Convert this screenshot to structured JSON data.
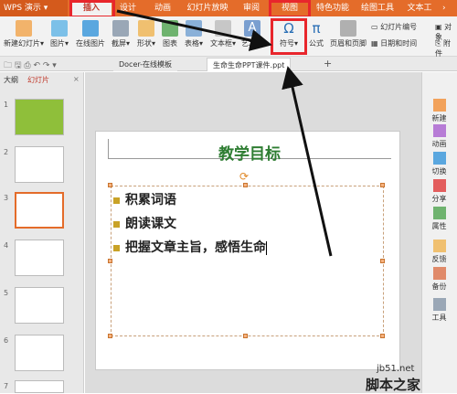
{
  "app": {
    "name": "WPS 演示"
  },
  "tabs": [
    "插入",
    "设计",
    "动画",
    "幻灯片放映",
    "审阅",
    "视图",
    "特色功能",
    "绘图工具",
    "文本工"
  ],
  "ribbon": {
    "new_slide": "新建幻灯片",
    "image": "图片",
    "online_image": "在线图片",
    "screenshot": "截屏",
    "shape": "形状",
    "chart": "图表",
    "table": "表格",
    "textbox": "文本框",
    "art": "艺术字",
    "symbol": "符号",
    "formula": "公式",
    "header_footer": "页眉和页脚",
    "slide_number": "幻灯片编号",
    "datetime": "日期和时间",
    "object": "对象",
    "attachment": "附件"
  },
  "doc_tabs": [
    "Docer-在线模板",
    "生命生命PPT课件.ppt"
  ],
  "left_panel": {
    "tab_outline": "大纲",
    "tab_slides": "幻灯片",
    "slide_numbers": [
      "1",
      "2",
      "3",
      "4",
      "5",
      "6",
      "7"
    ]
  },
  "slide": {
    "title": "教学目标",
    "bullets": [
      "积累词语",
      "朗读课文",
      "把握文章主旨，感悟生命"
    ]
  },
  "right_panel": [
    "新建",
    "动画",
    "切换",
    "分享",
    "属性",
    "反馈",
    "备份",
    "工具"
  ],
  "watermark": {
    "url": "jb51.net",
    "name": "脚本之家"
  },
  "colors": {
    "accent": "#e46c2a",
    "highlight": "#e8262c",
    "title_green": "#2e7d32"
  }
}
